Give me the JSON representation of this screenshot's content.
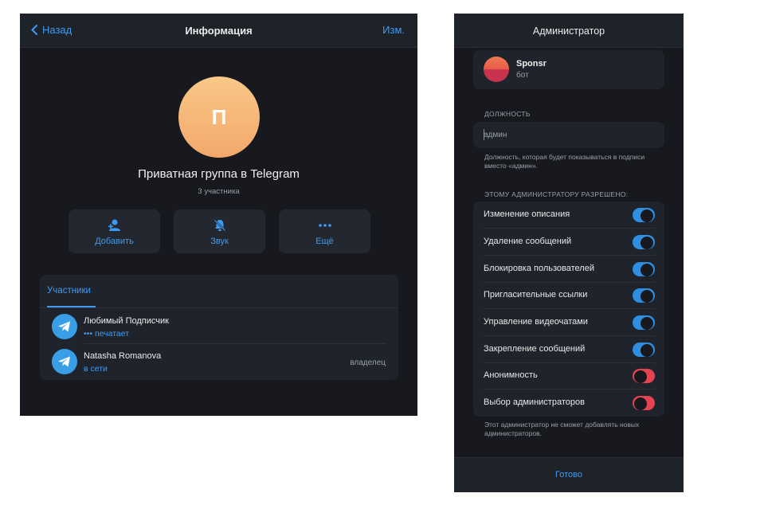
{
  "info_panel": {
    "header": {
      "back_label": "Назад",
      "title": "Информация",
      "edit_label": "Изм."
    },
    "avatar_letter": "П",
    "group_name": "Приватная группа в Telegram",
    "member_count": "3 участника",
    "actions": [
      {
        "label": "Добавить",
        "icon": "add-user-icon"
      },
      {
        "label": "Звук",
        "icon": "bell-muted-icon"
      },
      {
        "label": "Ещё",
        "icon": "more-icon"
      }
    ],
    "members_tab": "Участники",
    "members": [
      {
        "name": "Любимый Подписчик",
        "status": "••• печатает",
        "role": ""
      },
      {
        "name": "Natasha Romanova",
        "status": "в сети",
        "role": "владелец"
      }
    ]
  },
  "admin_panel": {
    "title": "Администратор",
    "bot": {
      "name": "Sponsr",
      "type": "бот"
    },
    "position_section": "ДОЛЖНОСТЬ",
    "position_placeholder": "админ",
    "position_hint": "Должность, которая будет показываться в подписи вместо «админ».",
    "permissions_section": "ЭТОМУ АДМИНИСТРАТОРУ РАЗРЕШЕНО:",
    "permissions": [
      {
        "label": "Изменение описания",
        "enabled": true
      },
      {
        "label": "Удаление сообщений",
        "enabled": true
      },
      {
        "label": "Блокировка пользователей",
        "enabled": true
      },
      {
        "label": "Пригласительные ссылки",
        "enabled": true
      },
      {
        "label": "Управление видеочатами",
        "enabled": true
      },
      {
        "label": "Закрепление сообщений",
        "enabled": true
      },
      {
        "label": "Анонимность",
        "enabled": false
      },
      {
        "label": "Выбор администраторов",
        "enabled": false
      }
    ],
    "permissions_hint": "Этот администратор не сможет добавлять новых администраторов.",
    "done_label": "Готово"
  },
  "colors": {
    "accent": "#3d9bf4",
    "background": "#17191e",
    "toggle_on": "#2f8ee0",
    "toggle_off": "#e5434f"
  }
}
